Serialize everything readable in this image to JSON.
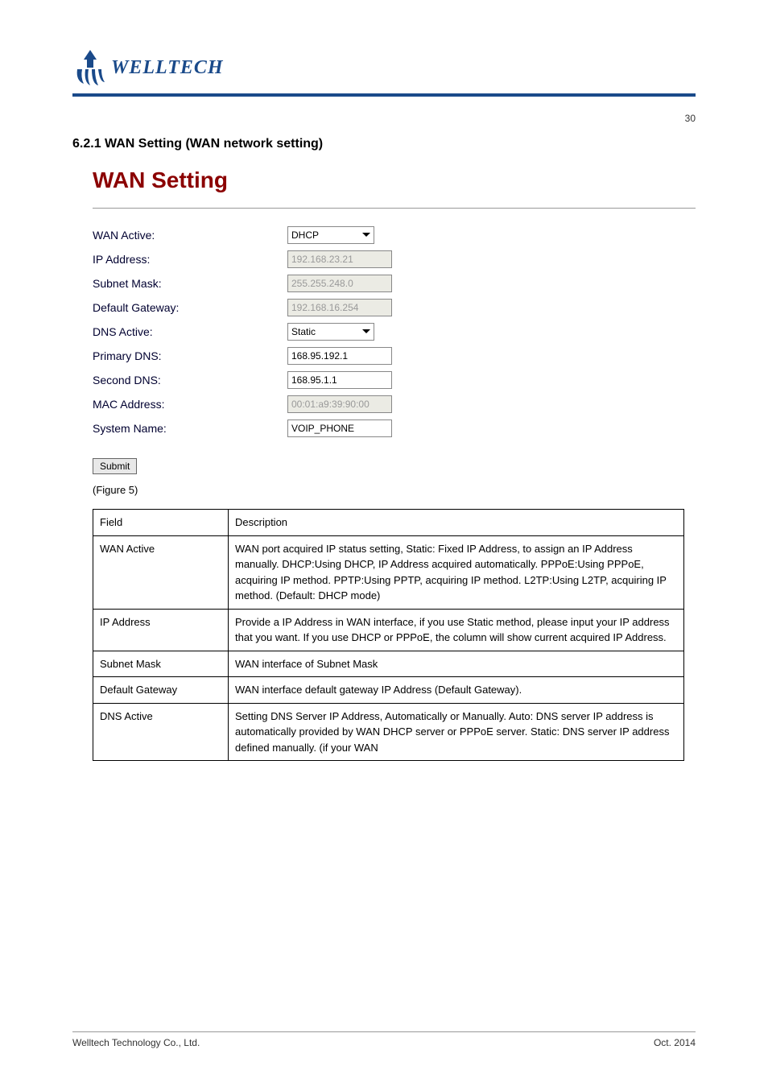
{
  "logo_text": "WELLTECH",
  "page_number_top": "30",
  "section_heading": "6.2.1 WAN Setting (WAN network setting)",
  "panel_title": "WAN Setting",
  "form": {
    "wan_active": {
      "label": "WAN Active:",
      "value": "DHCP"
    },
    "ip_address": {
      "label": "IP Address:",
      "value": "192.168.23.21"
    },
    "subnet_mask": {
      "label": "Subnet Mask:",
      "value": "255.255.248.0"
    },
    "default_gateway": {
      "label": "Default Gateway:",
      "value": "192.168.16.254"
    },
    "dns_active": {
      "label": "DNS Active:",
      "value": "Static"
    },
    "primary_dns": {
      "label": "Primary DNS:",
      "value": "168.95.192.1"
    },
    "second_dns": {
      "label": "Second DNS:",
      "value": "168.95.1.1"
    },
    "mac_address": {
      "label": "MAC Address:",
      "value": "00:01:a9:39:90:00"
    },
    "system_name": {
      "label": "System Name:",
      "value": "VOIP_PHONE"
    }
  },
  "submit_label": "Submit",
  "figure_caption": "(Figure 5)",
  "table": {
    "header": {
      "field": "Field",
      "description": "Description"
    },
    "rows": [
      {
        "field": "WAN Active",
        "description": "WAN port acquired IP status setting, Static: Fixed IP Address, to assign an IP Address manually. DHCP:Using DHCP, IP Address acquired automatically. PPPoE:Using PPPoE, acquiring IP method. PPTP:Using PPTP, acquiring IP method. L2TP:Using L2TP, acquiring IP method. (Default: DHCP mode)"
      },
      {
        "field": "IP Address",
        "description": "Provide a IP Address in WAN interface, if you use Static method, please input your IP address that you want. If you use DHCP or PPPoE, the column will show current acquired IP Address."
      },
      {
        "field": "Subnet Mask",
        "description": "WAN interface of Subnet Mask"
      },
      {
        "field": "Default Gateway",
        "description": "WAN interface default gateway IP Address (Default Gateway)."
      },
      {
        "field": "DNS Active",
        "description": "Setting DNS Server IP Address, Automatically or Manually. Auto: DNS server IP address is automatically provided by WAN DHCP server or PPPoE server. Static: DNS server IP address defined manually. (if your WAN"
      }
    ]
  },
  "footer": {
    "left": "Welltech Technology Co., Ltd.",
    "right": "Oct. 2014"
  }
}
